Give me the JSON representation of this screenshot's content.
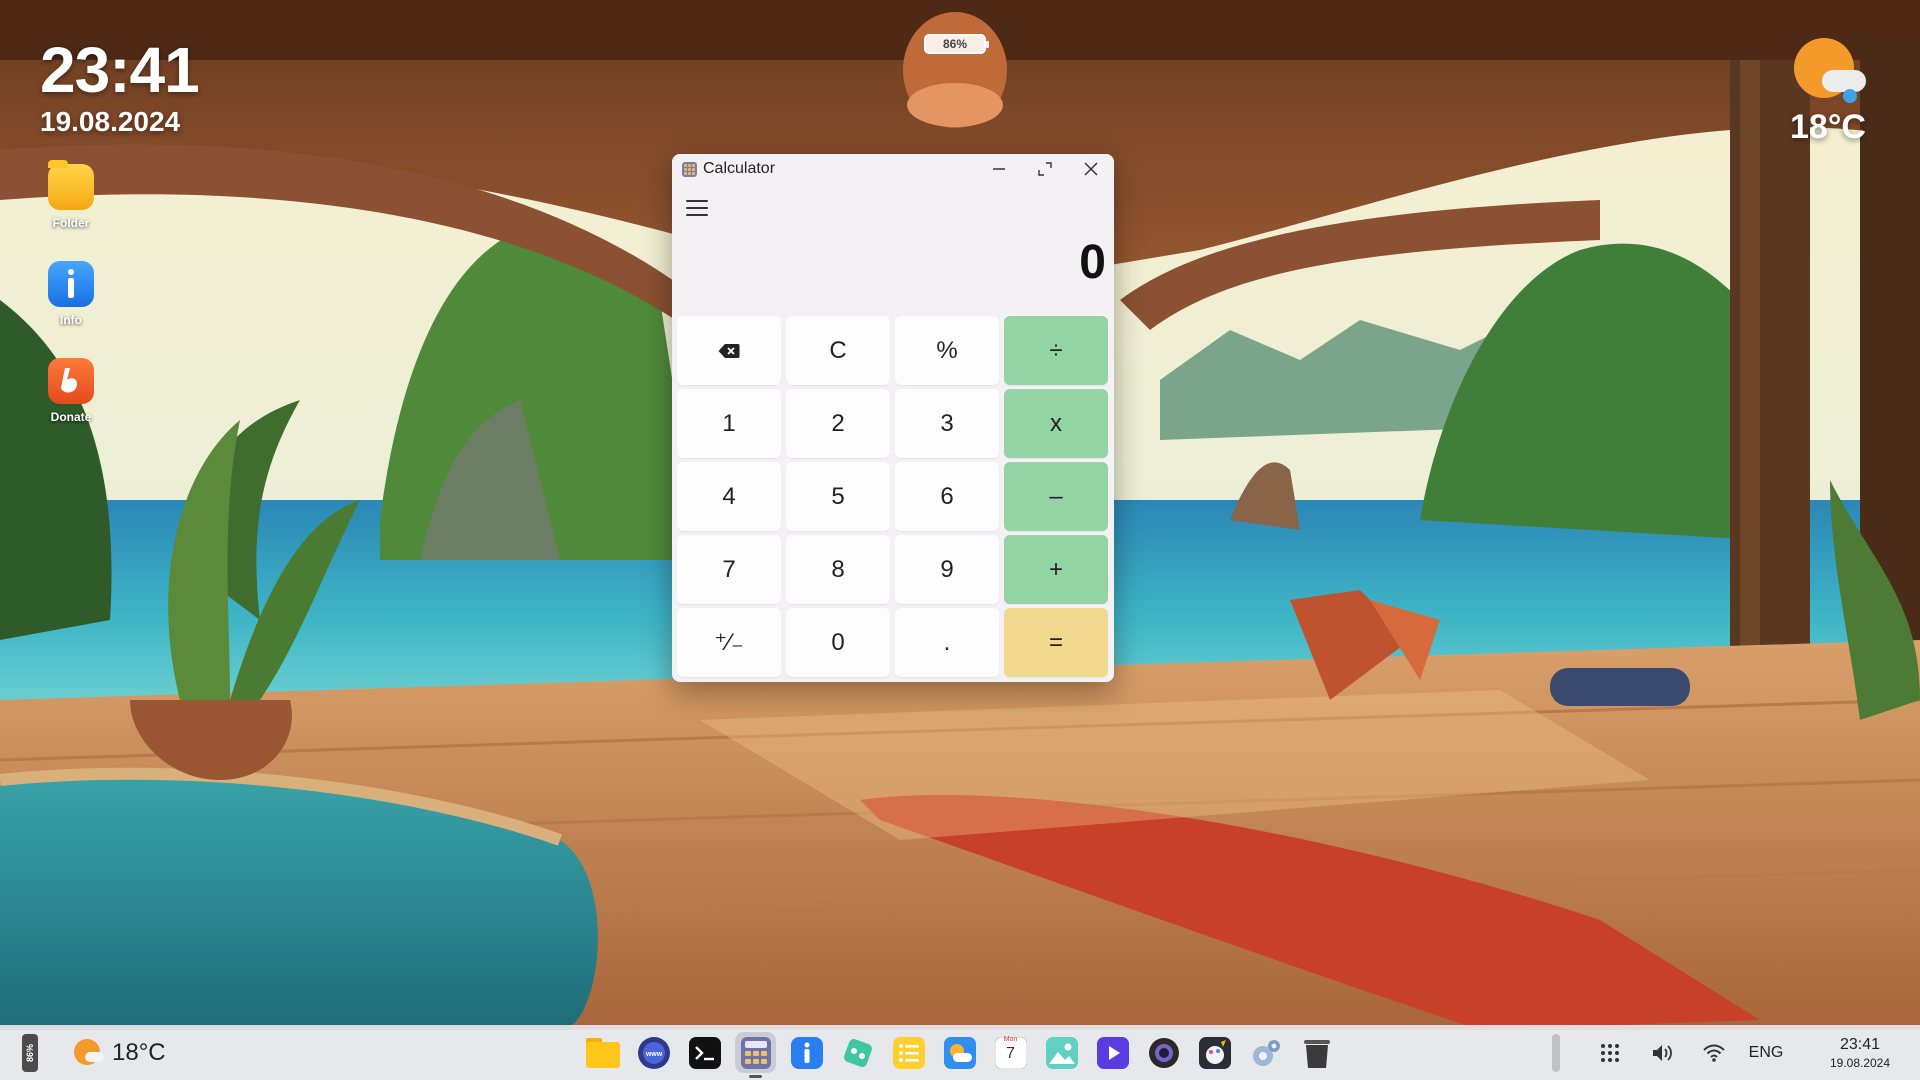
{
  "desktop": {
    "clock": {
      "time": "23:41",
      "date": "19.08.2024"
    },
    "weather": {
      "temperature": "18°C",
      "icon": "sun-cloud-icon"
    },
    "battery_indicator": "86%",
    "icons": [
      {
        "label": "Folder",
        "icon": "folder-icon"
      },
      {
        "label": "Info",
        "icon": "info-icon"
      },
      {
        "label": "Donate",
        "icon": "donate-icon"
      }
    ]
  },
  "calculator": {
    "title": "Calculator",
    "display": "0",
    "keys": {
      "c": "C",
      "percent": "%",
      "divide": "÷",
      "one": "1",
      "two": "2",
      "three": "3",
      "multiply": "x",
      "four": "4",
      "five": "5",
      "six": "6",
      "minus": "–",
      "seven": "7",
      "eight": "8",
      "nine": "9",
      "plus": "+",
      "negate": "⁺∕₋",
      "zero": "0",
      "decimal": ".",
      "equals": "="
    },
    "colors": {
      "operator": "#93d4a4",
      "equals": "#f0d98c",
      "window": "#f3f1f4"
    }
  },
  "taskbar": {
    "battery": "86%",
    "weather_temp": "18°C",
    "apps": [
      "folder-app-icon",
      "browser-app-icon",
      "terminal-app-icon",
      "calculator-app-icon",
      "info-app-icon",
      "game-app-icon",
      "notes-app-icon",
      "weather-app-icon",
      "calendar-app-icon",
      "gallery-app-icon",
      "video-player-app-icon",
      "camera-app-icon",
      "paint-app-icon",
      "settings-app-icon",
      "trash-app-icon"
    ],
    "calendar": {
      "weekday": "Mon",
      "day": "7"
    },
    "language": "ENG",
    "clock": {
      "time": "23:41",
      "date": "19.08.2024"
    }
  }
}
